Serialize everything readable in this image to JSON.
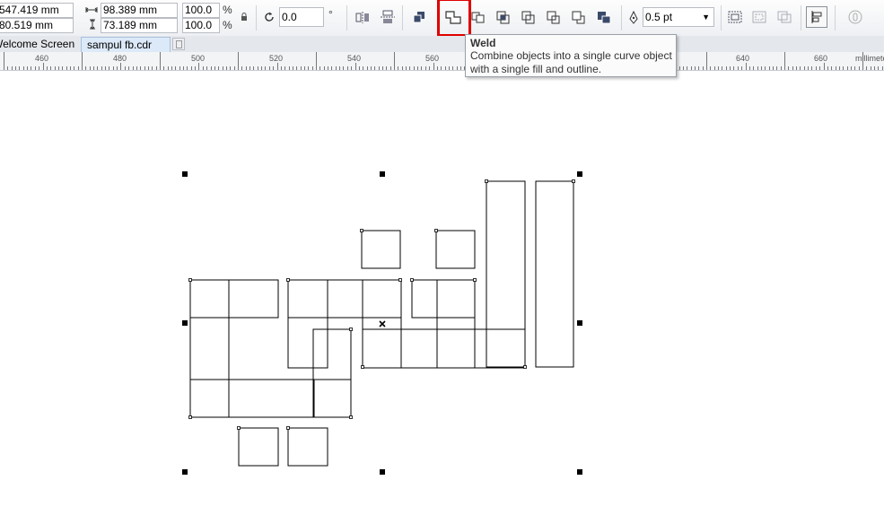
{
  "property_bar": {
    "x_position": "547.419 mm",
    "y_position": "80.519 mm",
    "width": "98.389 mm",
    "height": "73.189 mm",
    "scale_x": "100.0",
    "scale_y": "100.0",
    "percent_sign": "%",
    "rotation": "0.0",
    "degree_sign": "°",
    "outline_width": "0.5 pt"
  },
  "tabs": [
    {
      "label": "Welcome Screen"
    },
    {
      "label": "sampul fb.cdr"
    }
  ],
  "ruler": {
    "ticks": [
      "460",
      "480",
      "500",
      "520",
      "540",
      "560",
      "640",
      "660"
    ],
    "unit": "millimeters"
  },
  "tooltip": {
    "title": "Weld",
    "description": "Combine objects into a single curve object with a single fill and outline."
  },
  "icons": {
    "lock": "lock-icon",
    "rotate": "rotate-icon",
    "weld": "weld-icon"
  },
  "colors": {
    "highlight": "#e00000",
    "tab_active": "#dce9f8"
  }
}
